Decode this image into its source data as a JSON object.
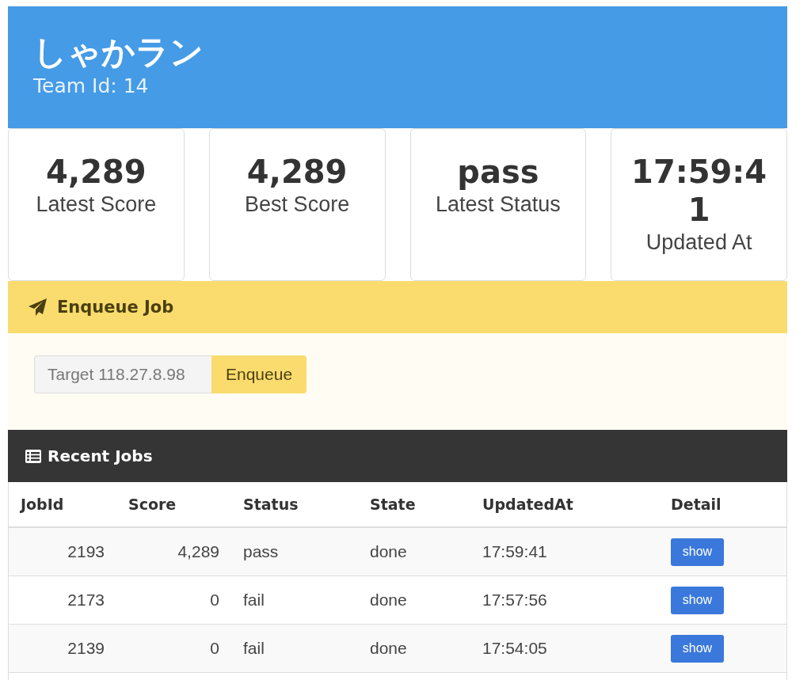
{
  "header": {
    "title": "しゃかラン",
    "subtitle": "Team Id: 14"
  },
  "stats": [
    {
      "value": "4,289",
      "label": "Latest Score"
    },
    {
      "value": "4,289",
      "label": "Best Score"
    },
    {
      "value": "pass",
      "label": "Latest Status"
    },
    {
      "value": "17:59:41",
      "label": "Updated At"
    }
  ],
  "enqueue": {
    "title": "Enqueue Job",
    "placeholder": "Target 118.27.8.98",
    "button": "Enqueue"
  },
  "recent_jobs": {
    "title": "Recent Jobs",
    "columns": [
      "JobId",
      "Score",
      "Status",
      "State",
      "UpdatedAt",
      "Detail"
    ],
    "rows": [
      {
        "cells": [
          "2193",
          "4,289",
          "pass",
          "done",
          "17:59:41"
        ],
        "action": "show"
      },
      {
        "cells": [
          "2173",
          "0",
          "fail",
          "done",
          "17:57:56"
        ],
        "action": "show"
      },
      {
        "cells": [
          "2139",
          "0",
          "fail",
          "done",
          "17:54:05"
        ],
        "action": "show"
      }
    ]
  }
}
